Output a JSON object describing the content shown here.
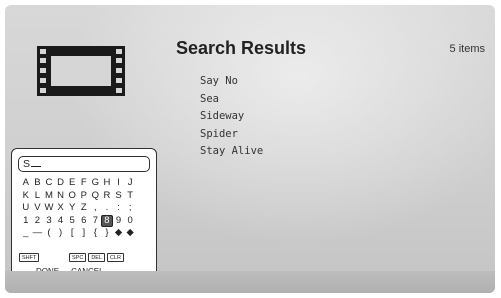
{
  "header": {
    "title": "Search Results",
    "item_count": "5 items"
  },
  "results": [
    "Say No",
    "Sea",
    "Sideway",
    "Spider",
    "Stay Alive"
  ],
  "keyboard": {
    "input_text": "S",
    "rows": [
      [
        "A",
        "B",
        "C",
        "D",
        "E",
        "F",
        "G",
        "H",
        "I",
        "J"
      ],
      [
        "K",
        "L",
        "M",
        "N",
        "O",
        "P",
        "Q",
        "R",
        "S",
        "T"
      ],
      [
        "U",
        "V",
        "W",
        "X",
        "Y",
        "Z",
        ",",
        "",
        ".",
        ":",
        ";"
      ],
      [
        "1",
        "2",
        "3",
        "4",
        "5",
        "6",
        "7",
        "8",
        "9",
        "0"
      ],
      [
        "_",
        "—",
        "(",
        ")",
        "[",
        "]",
        "{",
        "}",
        "◆",
        "◆"
      ]
    ],
    "selected_key": "8",
    "function_keys": {
      "shift": "SHFT",
      "space": "SPC",
      "delete": "DEL",
      "clear": "CLR"
    },
    "done_label": "DONE",
    "cancel_label": "CANCEL"
  },
  "icons": {
    "film": "film-strip-icon"
  }
}
